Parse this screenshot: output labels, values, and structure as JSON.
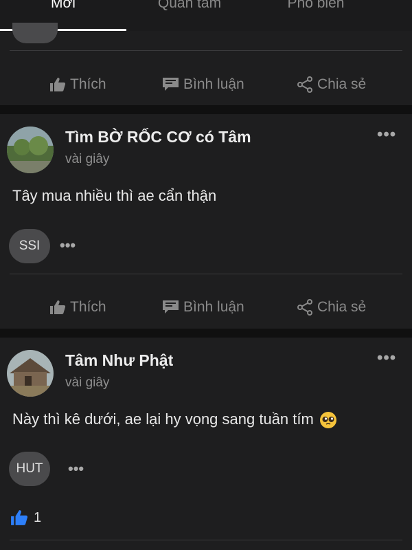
{
  "tabs": [
    {
      "label": "Mới"
    },
    {
      "label": "Quan tâm"
    },
    {
      "label": "Phổ biến"
    }
  ],
  "actions": {
    "like": "Thích",
    "comment": "Bình luận",
    "share": "Chia sẻ"
  },
  "posts": [
    {
      "author": "Tìm BỜ RỐC CƠ có Tâm",
      "time": "vài giây",
      "text": "Tây mua nhiều thì ae cẩn thận",
      "tag": "SSI"
    },
    {
      "author": "Tâm Như Phật",
      "time": "vài giây",
      "text": "Này thì kê dưới, ae lại hy vọng sang tuần tím",
      "tag": "HUT",
      "likes": "1"
    }
  ],
  "colors": {
    "background": "#101010",
    "card": "#1e1e1f",
    "muted": "#8a8a8a",
    "like_blue": "#2d7ff9"
  }
}
